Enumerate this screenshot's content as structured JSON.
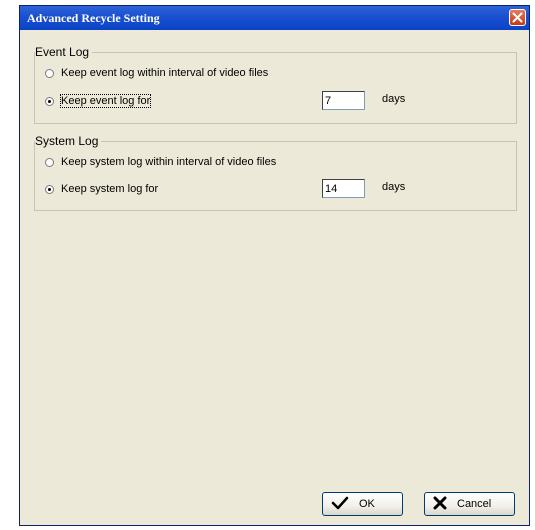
{
  "window": {
    "title": "Advanced Recycle Setting",
    "close_icon": "close-icon"
  },
  "event_log": {
    "group_title": "Event Log",
    "option_interval_label": "Keep event log within interval of video files",
    "option_days_label": "Keep event log for",
    "selected_option": "days",
    "days_value": "7",
    "days_unit": "days"
  },
  "system_log": {
    "group_title": "System Log",
    "option_interval_label": "Keep system log within interval of video files",
    "option_days_label": "Keep system log for",
    "selected_option": "days",
    "days_value": "14",
    "days_unit": "days"
  },
  "buttons": {
    "ok_label": "OK",
    "ok_icon": "checkmark-icon",
    "cancel_label": "Cancel",
    "cancel_icon": "x-icon"
  },
  "colors": {
    "titlebar": "#0a43c6",
    "dialog_bg": "#ece9d8",
    "close_button": "#c23a18"
  }
}
